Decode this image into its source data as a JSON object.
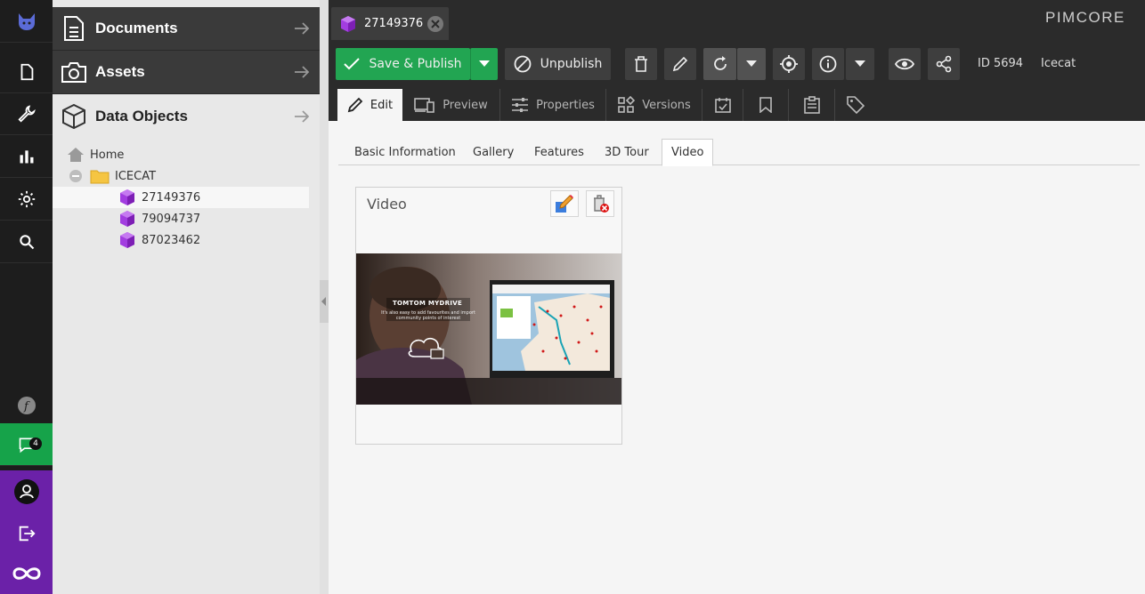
{
  "rail": {
    "notification_count": "4"
  },
  "tree_panel": {
    "sections": [
      {
        "label": "Documents"
      },
      {
        "label": "Assets"
      },
      {
        "label": "Data Objects"
      }
    ],
    "tree": {
      "home": "Home",
      "folder": "ICECAT",
      "items": [
        "27149376",
        "79094737",
        "87023462"
      ]
    }
  },
  "editor": {
    "tab_label": "27149376",
    "logo": "PIMCORE",
    "toolbar": {
      "save_publish": "Save & Publish",
      "unpublish": "Unpublish",
      "id_label": "ID 5694",
      "class_label": "Icecat"
    },
    "sub_tabs": {
      "edit": "Edit",
      "preview": "Preview",
      "properties": "Properties",
      "versions": "Versions"
    },
    "inner_tabs": [
      "Basic Information",
      "Gallery",
      "Features",
      "3D Tour",
      "Video"
    ],
    "video_panel": {
      "title": "Video",
      "thumbnail_headline": "TOMTOM MYDRIVE",
      "thumbnail_caption": "It's also easy to add favourites and import community points of interest"
    }
  },
  "colors": {
    "accent_green": "#22a552",
    "rail_purple": "#6b21a8",
    "object_purple": "#8b24c9"
  }
}
